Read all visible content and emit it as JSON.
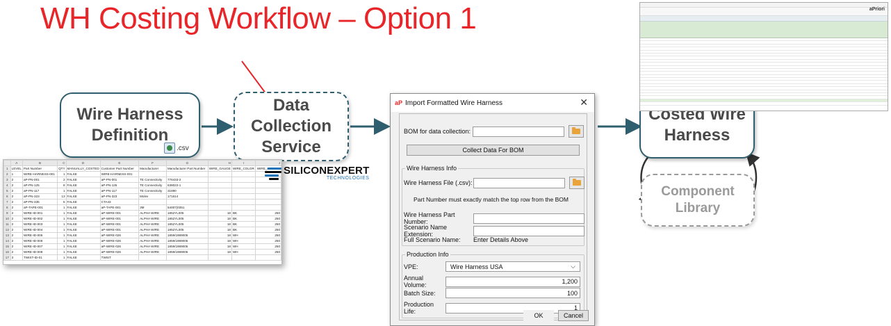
{
  "title": "WH Costing Workflow – Option 1",
  "nodes": {
    "definition": "Wire Harness Definition",
    "data_collection": "Data Collection Service",
    "costed": "Costed Wire Harness",
    "library": "Component Library"
  },
  "csv_label": ".csv",
  "siliconexpert": {
    "name": "SILICONEXPERT",
    "sub": "TECHNOLOGIES"
  },
  "spreadsheet": {
    "columns": [
      "",
      "A",
      "B",
      "C",
      "D",
      "E",
      "F",
      "G",
      "H",
      "I",
      "J"
    ],
    "header": [
      "1",
      "LEVEL",
      "Part Number",
      "QTY",
      "MANUALLY_COSTED",
      "Customer Part Number",
      "Manufacturer",
      "Manufacturer Part Number",
      "WIRE_GAUGE",
      "WIRE_COLOR",
      "WIRE_LENGTH"
    ],
    "rows": [
      [
        "2",
        "1",
        "WIRE-HARNESS-001",
        "1",
        "FALSE",
        "WIRE-HARNESS-001",
        "",
        "",
        "",
        "",
        ""
      ],
      [
        "3",
        "2",
        "aP-PN-001",
        "2",
        "FALSE",
        "aP-PN-001",
        "TE Connectivity",
        "776433-2",
        "",
        "",
        ""
      ],
      [
        "4",
        "2",
        "aP-PN-125",
        "8",
        "FALSE",
        "aP-PN-125",
        "TE Connectivity",
        "638022-1",
        "",
        "",
        ""
      ],
      [
        "5",
        "2",
        "aP-PN-117",
        "1",
        "FALSE",
        "aP-PN-117",
        "TE Connectivity",
        "31890",
        "",
        "",
        ""
      ],
      [
        "6",
        "2",
        "aP-PN-323",
        "13",
        "FALSE",
        "aP-PN-323",
        "Molex",
        "171614",
        "",
        "",
        ""
      ],
      [
        "7",
        "2",
        "aP-PN-335",
        "5",
        "FALSE",
        "CTA43",
        "",
        "",
        "",
        "",
        ""
      ],
      [
        "8",
        "2",
        "aP-TAPE-001",
        "1",
        "FALSE",
        "aP-TAPE-001",
        "3M",
        "54007(0351",
        "",
        "",
        ""
      ],
      [
        "9",
        "2",
        "WIRE-ID-001",
        "1",
        "FALSE",
        "aP-WIRE-001",
        "ALPHA WIRE",
        "1852YL005",
        "18",
        "BK",
        "250"
      ],
      [
        "10",
        "2",
        "WIRE-ID-002",
        "1",
        "FALSE",
        "aP-WIRE-001",
        "ALPHA WIRE",
        "1852YL005",
        "18",
        "BK",
        "250"
      ],
      [
        "11",
        "2",
        "WIRE-ID-003",
        "1",
        "FALSE",
        "aP-WIRE-001",
        "ALPHA WIRE",
        "1852YL005",
        "18",
        "BK",
        "250"
      ],
      [
        "12",
        "2",
        "WIRE-ID-004",
        "1",
        "FALSE",
        "aP-WIRE-001",
        "ALPHA WIRE",
        "1852YL005",
        "18",
        "BK",
        "250"
      ],
      [
        "13",
        "2",
        "WIRE-ID-005",
        "1",
        "FALSE",
        "aP-WIRE-026",
        "ALPHA WIRE",
        "1859/1989005",
        "18",
        "WH",
        "250"
      ],
      [
        "14",
        "2",
        "WIRE-ID-006",
        "1",
        "FALSE",
        "aP-WIRE-026",
        "ALPHA WIRE",
        "1859/1989005",
        "18",
        "WH",
        "250"
      ],
      [
        "15",
        "2",
        "WIRE-ID-007",
        "1",
        "FALSE",
        "aP-WIRE-026",
        "ALPHA WIRE",
        "1859/1989005",
        "18",
        "WH",
        "250"
      ],
      [
        "16",
        "2",
        "WIRE-ID-008",
        "1",
        "FALSE",
        "aP-WIRE-026",
        "ALPHA WIRE",
        "1859/1989005",
        "18",
        "WH",
        "250"
      ],
      [
        "17",
        "3",
        "TWIST-ID-01",
        "1",
        "FALSE",
        "TWIST",
        "",
        "",
        "",
        "",
        ""
      ]
    ]
  },
  "dialog": {
    "title": "Import Formatted Wire Harness",
    "bom_label": "BOM for data collection:",
    "collect_button": "Collect Data For BOM",
    "wh_info_label": "Wire Harness Info",
    "wh_file_label": "Wire Harness File (.csv):",
    "note": "Part Number must exactly match the top row from the BOM",
    "wh_part_label": "Wire Harness Part Number:",
    "scenario_ext_label": "Scenario Name Extension:",
    "full_scenario_label": "Full Scenario Name:",
    "full_scenario_value": "Enter Details Above",
    "prod_info_label": "Production Info",
    "vpe_label": "VPE:",
    "vpe_value": "Wire Harness USA",
    "annual_label": "Annual Volume:",
    "annual_value": "1,200",
    "batch_label": "Batch Size:",
    "batch_value": "100",
    "life_label": "Production Life:",
    "life_value": "1",
    "ok": "OK",
    "cancel": "Cancel"
  },
  "app_brand": "aPriori",
  "colors": {
    "title": "#e8262a",
    "node_border": "#2f5f6e",
    "arrow": "#2f5f6e",
    "red_arrow": "#e8262a"
  }
}
